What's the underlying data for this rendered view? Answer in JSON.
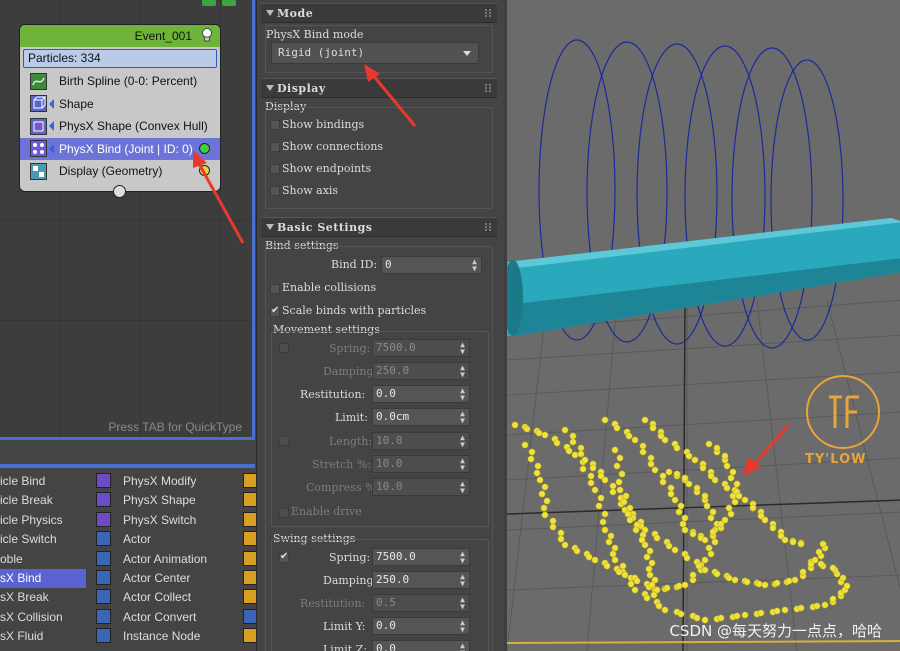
{
  "particle_view": {
    "event_title": "Event_001",
    "particles": "Particles: 334",
    "operators": [
      {
        "label": "Birth Spline (0-0: Percent)",
        "icon": "birth-spline-icon",
        "color": "#3a8a3a"
      },
      {
        "label": "Shape",
        "icon": "shape-icon",
        "color": "#5a66c8"
      },
      {
        "label": "PhysX Shape (Convex Hull)",
        "icon": "physx-shape-icon",
        "color": "#5a66c8"
      },
      {
        "label": "PhysX Bind (Joint | ID: 0)",
        "icon": "physx-bind-icon",
        "color": "#6c5ad8"
      },
      {
        "label": "Display (Geometry)",
        "icon": "display-icon",
        "color": "#4a9ab4"
      }
    ],
    "quicktype_hint": "Press TAB for QuickType"
  },
  "depot": {
    "col1": [
      "icle Bind",
      "icle Break",
      "icle Physics",
      "icle Switch",
      "oble",
      "sX Bind",
      "sX Break",
      "sX Collision",
      "sX Fluid"
    ],
    "col2": [
      "PhysX Modify",
      "PhysX Shape",
      "PhysX Switch",
      "Actor",
      "Actor Animation",
      "Actor Center",
      "Actor Collect",
      "Actor Convert",
      "Instance Node"
    ],
    "selected_index": 5
  },
  "panel": {
    "mode": {
      "header": "Mode",
      "bind_mode_label": "PhysX Bind mode",
      "bind_mode_value": "Rigid (joint)"
    },
    "display": {
      "header": "Display",
      "group_label": "Display",
      "options": [
        {
          "label": "Show bindings",
          "checked": false
        },
        {
          "label": "Show connections",
          "checked": false
        },
        {
          "label": "Show endpoints",
          "checked": false
        },
        {
          "label": "Show axis",
          "checked": false
        }
      ]
    },
    "basic": {
      "header": "Basic Settings",
      "bind_settings_label": "Bind settings",
      "bind_id_label": "Bind ID:",
      "bind_id_value": "0",
      "enable_collisions": "Enable collisions",
      "scale_binds": "Scale binds with particles",
      "movement_label": "Movement settings",
      "movement": [
        {
          "label": "Spring:",
          "value": "7500.0",
          "enabled": false
        },
        {
          "label": "Damping:",
          "value": "250.0",
          "enabled": false
        },
        {
          "label": "Restitution:",
          "value": "0.0",
          "enabled": true
        },
        {
          "label": "Limit:",
          "value": "0.0cm",
          "enabled": true
        },
        {
          "label": "Length:",
          "value": "10.0",
          "enabled": false
        },
        {
          "label": "Stretch %:",
          "value": "10.0",
          "enabled": false
        },
        {
          "label": "Compress %:",
          "value": "10.0",
          "enabled": false
        }
      ],
      "enable_drive": "Enable drive",
      "swing_label": "Swing settings",
      "swing": [
        {
          "label": "Spring:",
          "value": "7500.0",
          "enabled": true
        },
        {
          "label": "Damping:",
          "value": "250.0",
          "enabled": true
        },
        {
          "label": "Restitution:",
          "value": "0.5",
          "enabled": false
        },
        {
          "label": "Limit Y:",
          "value": "0.0",
          "enabled": true
        },
        {
          "label": "Limit Z:",
          "value": "0.0",
          "enabled": true
        }
      ]
    }
  },
  "viewport": {
    "logo_text": "TY'LOW",
    "watermark": "CSDN @每天努力一点点，哈哈",
    "cylinder_color": "#2aa9bd",
    "helix_color": "#1c2a9a",
    "particle_color": "#f0e23a"
  },
  "annotation_color": "#e8392c"
}
